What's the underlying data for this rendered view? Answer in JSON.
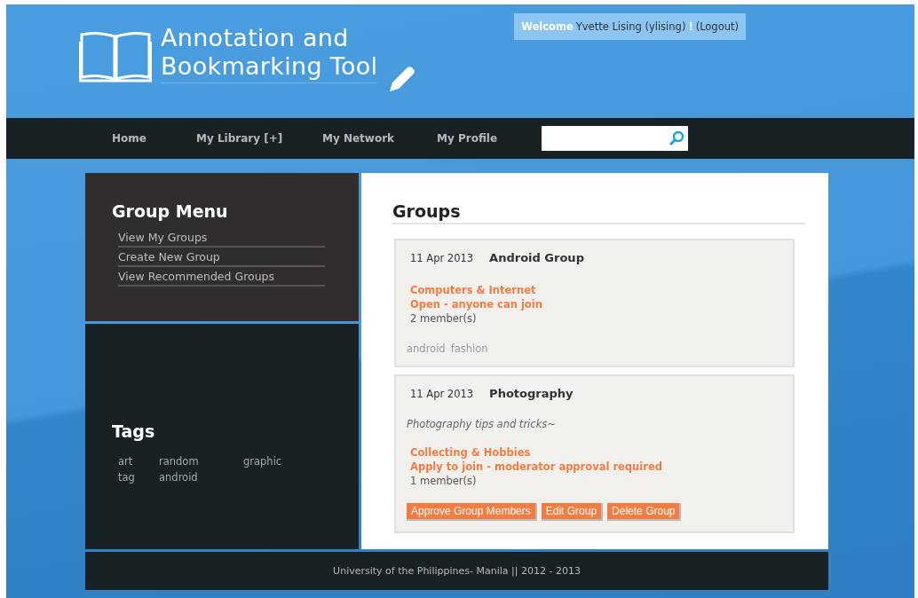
{
  "header": {
    "title_lines": [
      "Annotation and",
      "Bookmarking Tool"
    ],
    "welcome": {
      "label": "Welcome",
      "user": "Yvette Lising (ylising)",
      "mark": "!",
      "logout": "(Logout)"
    }
  },
  "nav": {
    "items": [
      "Home",
      "My Library [+]",
      "My Network",
      "My Profile"
    ]
  },
  "group_menu": {
    "title": "Group Menu",
    "items": [
      "View My Groups",
      "Create New Group",
      "View Recommended Groups"
    ]
  },
  "tags": {
    "title": "Tags",
    "items": [
      "art",
      "random",
      "graphic",
      "tag",
      "android"
    ]
  },
  "content": {
    "heading": "Groups",
    "groups": [
      {
        "date": "11 Apr 2013",
        "name": "Android Group",
        "category": "Computers & Internet",
        "access": "Open - anyone can join",
        "members": "2 member(s)",
        "tags": [
          "android",
          "fashion"
        ]
      },
      {
        "date": "11 Apr 2013",
        "name": "Photography",
        "description": "Photography tips and tricks~",
        "category": "Collecting & Hobbies",
        "access": "Apply to join - moderator approval required",
        "members": "1 member(s)",
        "buttons": [
          "Approve Group Members",
          "Edit Group",
          "Delete Group"
        ]
      }
    ]
  },
  "footer": "University of the Philippines- Manila || 2012 - 2013"
}
